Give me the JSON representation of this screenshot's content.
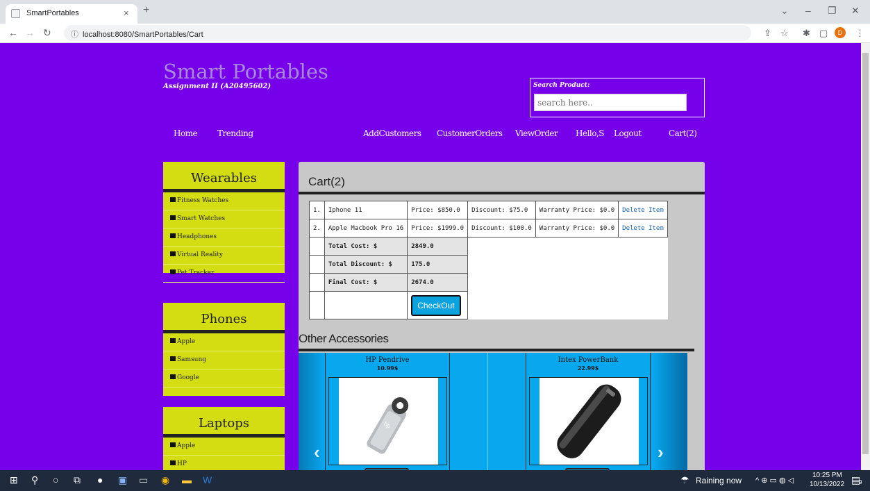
{
  "browser": {
    "tab_title": "SmartPortables",
    "tab_close": "×",
    "new_tab": "+",
    "url": "localhost:8080/SmartPortables/Cart",
    "profile_initial": "D"
  },
  "site": {
    "logo": "Smart Portables",
    "subtitle": "Assignment II (A20495602)",
    "search_label": "Search Product:",
    "search_placeholder": "search here.."
  },
  "nav": {
    "home": "Home",
    "trending": "Trending",
    "add_customers": "AddCustomers",
    "customer_orders": "CustomerOrders",
    "view_order": "ViewOrder",
    "hello": "Hello,S",
    "logout": "Logout",
    "cart": "Cart(2)"
  },
  "sidebar": {
    "wearables": {
      "title": "Wearables",
      "items": [
        "Fitness Watches",
        "Smart Watches",
        "Headphones",
        "Virtual Reality",
        "Pet Tracker"
      ]
    },
    "phones": {
      "title": "Phones",
      "items": [
        "Apple",
        "Samsung",
        "Google"
      ]
    },
    "laptops": {
      "title": "Laptops",
      "items": [
        "Apple",
        "HP"
      ]
    }
  },
  "cart": {
    "title": "Cart(2)",
    "rows": [
      {
        "num": "1.",
        "name": "Iphone 11",
        "price": "Price: $850.0",
        "discount": "Discount: $75.0",
        "warranty": "Warranty Price: $0.0",
        "action": "Delete Item"
      },
      {
        "num": "2.",
        "name": "Apple Macbook Pro 16",
        "price": "Price: $1999.0",
        "discount": "Discount: $100.0",
        "warranty": "Warranty Price: $0.0",
        "action": "Delete Item"
      }
    ],
    "total_cost_label": "Total Cost: $",
    "total_cost": "2849.0",
    "total_discount_label": "Total Discount: $",
    "total_discount": "175.0",
    "final_cost_label": "Final Cost: $",
    "final_cost": "2674.0",
    "checkout": "CheckOut"
  },
  "accessories": {
    "title": "Other Accessories",
    "items": [
      {
        "name": "HP Pendrive",
        "price": "10.99$"
      },
      {
        "name": "Intex PowerBank",
        "price": "22.99$"
      }
    ]
  },
  "taskbar": {
    "weather": "Raining now",
    "time": "10:25 PM",
    "date": "10/13/2022",
    "notifications": "9"
  }
}
